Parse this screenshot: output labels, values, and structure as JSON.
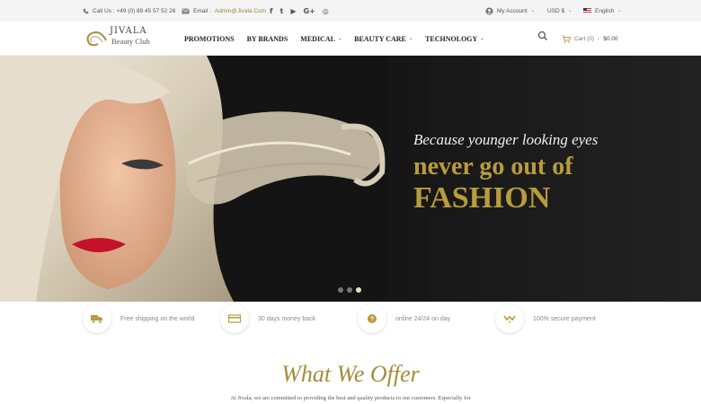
{
  "topbar": {
    "phone": "Call Us : +49 (0) 89 45 57 52 26",
    "email_label": "Email :",
    "email_value": "Admin@Jivala.Com",
    "social": [
      {
        "icon": "facebook-icon",
        "glyph": "f"
      },
      {
        "icon": "twitter-icon",
        "glyph": "t"
      },
      {
        "icon": "youtube-icon",
        "glyph": "▶"
      },
      {
        "icon": "google-plus-icon",
        "glyph": "G+"
      },
      {
        "icon": "instagram-icon",
        "glyph": "◎"
      }
    ],
    "account": "My Account",
    "currency": "USD $",
    "language": "English"
  },
  "header": {
    "logo_brand": "JIVALA",
    "logo_sub": "Beauty Club",
    "nav": [
      {
        "label": "PROMOTIONS",
        "has_dropdown": false
      },
      {
        "label": "BY BRANDS",
        "has_dropdown": false
      },
      {
        "label": "MEDICAL",
        "has_dropdown": true
      },
      {
        "label": "BEAUTY CARE",
        "has_dropdown": true
      },
      {
        "label": "TECHNOLOGY",
        "has_dropdown": true
      }
    ],
    "cart_label": "Cart (0)",
    "cart_amount": "$0.00"
  },
  "hero": {
    "line1": "Because younger looking eyes",
    "line2": "never go out of",
    "line3": "FASHION",
    "slides": 3,
    "active_slide": 3,
    "accent_color": "#b89c3d"
  },
  "features": [
    {
      "icon": "truck-icon",
      "text": "Free shipping on the world"
    },
    {
      "icon": "money-icon",
      "text": "30 days money back"
    },
    {
      "icon": "support-icon",
      "text": "online 24/24 on day"
    },
    {
      "icon": "secure-icon",
      "text": "100% secure payment"
    }
  ],
  "offer": {
    "title": "What We Offer",
    "text": "At Jivala, we are committed to providing the best and quality products to our customers. Especially for"
  }
}
